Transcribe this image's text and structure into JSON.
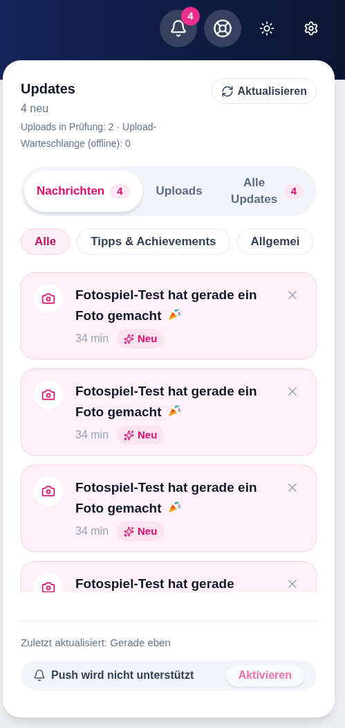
{
  "topbar": {
    "notification_count": "4"
  },
  "panel": {
    "title": "Updates",
    "new_count": "4 neu",
    "upload_status": "Uploads in Prüfung: 2 · Upload-Warteschlange (offline): 0",
    "refresh_label": "Aktualisieren"
  },
  "tabs": [
    {
      "label": "Nachrichten",
      "count": "4",
      "selected": true
    },
    {
      "label": "Uploads",
      "selected": false
    },
    {
      "label": "Alle Updates",
      "count": "4",
      "selected": false
    }
  ],
  "filters": [
    {
      "label": "Alle",
      "selected": true
    },
    {
      "label": "Tipps & Achievements",
      "selected": false
    },
    {
      "label": "Allgemei",
      "selected": false
    }
  ],
  "notifications": [
    {
      "title": "Fotospiel-Test hat gerade ein Foto gemacht",
      "time": "34 min",
      "badge": "Neu",
      "unread": true
    },
    {
      "title": "Fotospiel-Test hat gerade ein Foto gemacht",
      "time": "34 min",
      "badge": "Neu",
      "unread": true
    },
    {
      "title": "Fotospiel-Test hat gerade ein Foto gemacht",
      "time": "34 min",
      "badge": "Neu",
      "unread": true
    },
    {
      "title": "Fotospiel-Test hat gerade",
      "unread": true
    }
  ],
  "footer": {
    "last_updated": "Zuletzt aktualisiert: Gerade eben",
    "push_status": "Push wird nicht unterstützt",
    "activate_label": "Aktivieren",
    "activate_disabled": true
  }
}
